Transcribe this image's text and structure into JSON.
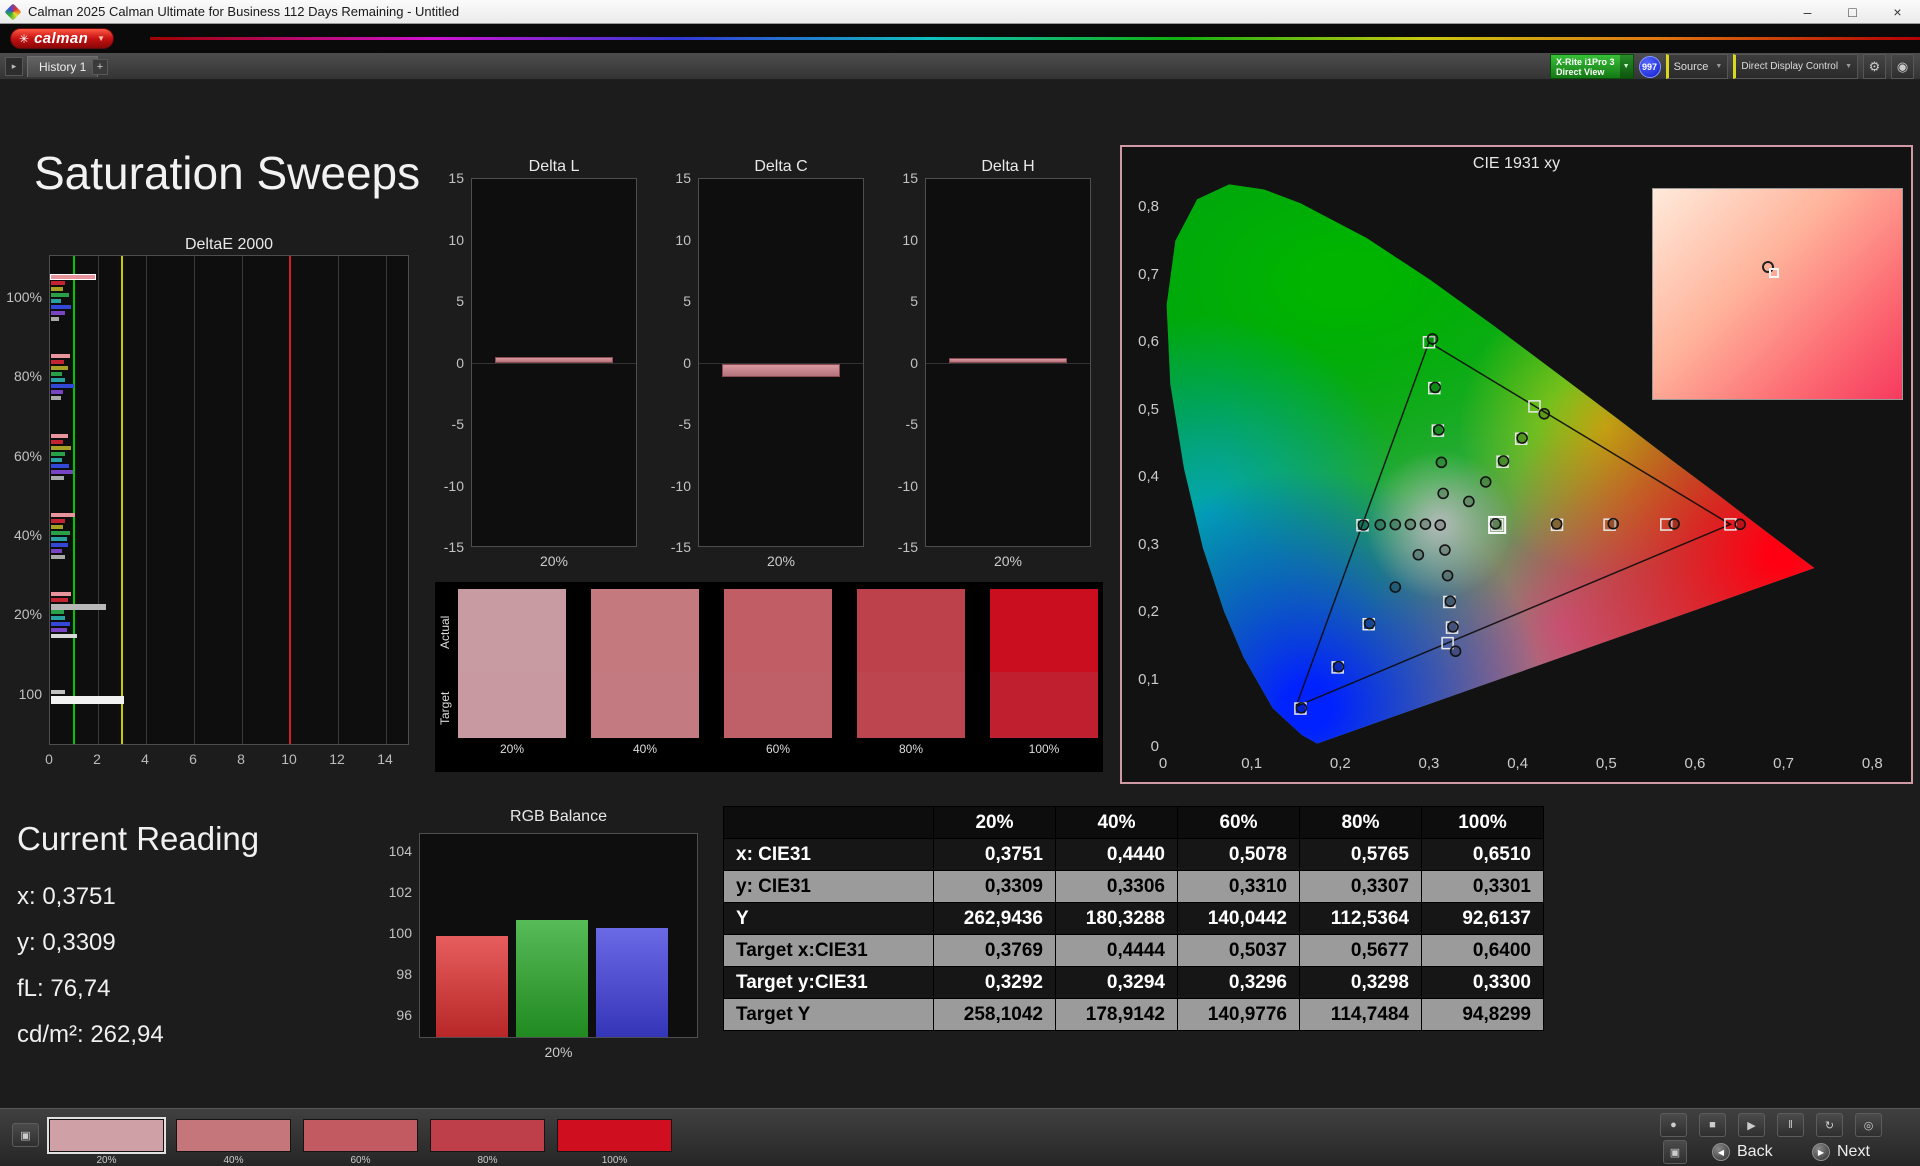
{
  "window": {
    "title": "Calman 2025 Calman Ultimate for Business 112 Days Remaining  - Untitled",
    "minimize": "–",
    "maximize": "□",
    "close": "×"
  },
  "brand": {
    "name": "calman",
    "star": "✳",
    "caret": "▼"
  },
  "toolbar": {
    "history_arrow": "▸",
    "history_tab": "History 1",
    "add_tab": "+",
    "meter_line1": "X-Rite i1Pro 3",
    "meter_line2": "Direct View",
    "meter_count": "997",
    "source_label": "Source",
    "display_control_label": "Direct Display Control",
    "caret": "▼",
    "gear": "⚙",
    "scope": "◉"
  },
  "page_title": "Saturation Sweeps",
  "deltae": {
    "title": "DeltaE 2000",
    "x_ticks": [
      0,
      2,
      4,
      6,
      8,
      10,
      12,
      14
    ],
    "x_max": 15,
    "ref_lines": [
      {
        "value": 1,
        "color": "#00c800"
      },
      {
        "value": 3,
        "color": "#c8c800"
      },
      {
        "value": 10,
        "color": "#d02020"
      }
    ],
    "groups": [
      {
        "label": "100%",
        "bars": [
          {
            "c": "#e8949c",
            "v": 1.85,
            "hl": true
          },
          {
            "c": "#c42432",
            "v": 0.6
          },
          {
            "c": "#a8a022",
            "v": 0.5
          },
          {
            "c": "#28a048",
            "v": 0.75
          },
          {
            "c": "#28a0a0",
            "v": 0.4
          },
          {
            "c": "#3448d8",
            "v": 0.85
          },
          {
            "c": "#7844c4",
            "v": 0.6
          },
          {
            "c": "#a8a8a8",
            "v": 0.35
          }
        ]
      },
      {
        "label": "80%",
        "bars": [
          {
            "c": "#e8949c",
            "v": 0.8
          },
          {
            "c": "#c42432",
            "v": 0.55
          },
          {
            "c": "#a8a022",
            "v": 0.7
          },
          {
            "c": "#28a048",
            "v": 0.45
          },
          {
            "c": "#28a0a0",
            "v": 0.6
          },
          {
            "c": "#3448d8",
            "v": 0.95
          },
          {
            "c": "#7844c4",
            "v": 0.5
          },
          {
            "c": "#a8a8a8",
            "v": 0.4
          }
        ]
      },
      {
        "label": "60%",
        "bars": [
          {
            "c": "#e8949c",
            "v": 0.7
          },
          {
            "c": "#c42432",
            "v": 0.5
          },
          {
            "c": "#a8a022",
            "v": 0.85
          },
          {
            "c": "#28a048",
            "v": 0.6
          },
          {
            "c": "#28a0a0",
            "v": 0.45
          },
          {
            "c": "#3448d8",
            "v": 0.75
          },
          {
            "c": "#7844c4",
            "v": 0.9
          },
          {
            "c": "#a8a8a8",
            "v": 0.55
          }
        ]
      },
      {
        "label": "40%",
        "bars": [
          {
            "c": "#e8949c",
            "v": 1.0
          },
          {
            "c": "#c42432",
            "v": 0.6
          },
          {
            "c": "#a8a022",
            "v": 0.5
          },
          {
            "c": "#28a048",
            "v": 0.8
          },
          {
            "c": "#28a0a0",
            "v": 0.65
          },
          {
            "c": "#3448d8",
            "v": 0.7
          },
          {
            "c": "#7844c4",
            "v": 0.45
          },
          {
            "c": "#a8a8a8",
            "v": 0.6
          }
        ]
      },
      {
        "label": "20%",
        "bars": [
          {
            "c": "#e8949c",
            "v": 0.85
          },
          {
            "c": "#c42432",
            "v": 0.7
          },
          {
            "c": "#b8b8b8",
            "v": 2.3,
            "h": 6
          },
          {
            "c": "#28a048",
            "v": 0.55
          },
          {
            "c": "#28a0a0",
            "v": 0.6
          },
          {
            "c": "#3448d8",
            "v": 0.8
          },
          {
            "c": "#7844c4",
            "v": 0.65
          },
          {
            "c": "#d8d8d8",
            "v": 1.1
          }
        ]
      },
      {
        "label": "100",
        "bars": [
          {
            "c": "#c0c0c0",
            "v": 0.6
          },
          {
            "c": "#f2f2f2",
            "v": 3.05,
            "h": 8
          }
        ]
      }
    ]
  },
  "delta_charts": [
    {
      "title": "Delta L",
      "value": 0.5,
      "x_label": "20%",
      "y_ticks": [
        15,
        10,
        5,
        0,
        -5,
        -10,
        -15
      ],
      "y_max": 15
    },
    {
      "title": "Delta C",
      "value": -1.1,
      "x_label": "20%",
      "y_ticks": [
        15,
        10,
        5,
        0,
        -5,
        -10,
        -15
      ],
      "y_max": 15
    },
    {
      "title": "Delta H",
      "value": 0.45,
      "x_label": "20%",
      "y_ticks": [
        15,
        10,
        5,
        0,
        -5,
        -10,
        -15
      ],
      "y_max": 15
    }
  ],
  "swatch_panel": {
    "row_labels": [
      "Actual",
      "Target"
    ],
    "swatches": [
      {
        "label": "20%",
        "actual": "#c79ba1",
        "target": "#c899a0"
      },
      {
        "label": "40%",
        "actual": "#c4797f",
        "target": "#c37a81"
      },
      {
        "label": "60%",
        "actual": "#c05d65",
        "target": "#bf5f68"
      },
      {
        "label": "80%",
        "actual": "#bd414b",
        "target": "#bc454f"
      },
      {
        "label": "100%",
        "actual": "#cb0e1f",
        "target": "#bf1f2e"
      }
    ]
  },
  "cie": {
    "title": "CIE 1931 xy",
    "x_ticks": [
      "0",
      "0,1",
      "0,2",
      "0,3",
      "0,4",
      "0,5",
      "0,6",
      "0,7",
      "0,8"
    ],
    "y_ticks": [
      "0",
      "0,1",
      "0,2",
      "0,3",
      "0,4",
      "0,5",
      "0,6",
      "0,7",
      "0,8"
    ],
    "x_range": [
      0,
      0.82
    ],
    "y_range": [
      0,
      0.845
    ],
    "triangle": [
      [
        0.64,
        0.33
      ],
      [
        0.3,
        0.6
      ],
      [
        0.15,
        0.06
      ]
    ],
    "measured": [
      [
        0.3751,
        0.3309
      ],
      [
        0.444,
        0.3306
      ],
      [
        0.5078,
        0.331
      ],
      [
        0.5765,
        0.3307
      ],
      [
        0.651,
        0.3301
      ],
      [
        0.296,
        0.3303
      ],
      [
        0.279,
        0.33
      ],
      [
        0.262,
        0.3297
      ],
      [
        0.245,
        0.3294
      ],
      [
        0.226,
        0.3291
      ],
      [
        0.316,
        0.376
      ],
      [
        0.314,
        0.422
      ],
      [
        0.311,
        0.47
      ],
      [
        0.307,
        0.533
      ],
      [
        0.304,
        0.605
      ],
      [
        0.345,
        0.364
      ],
      [
        0.364,
        0.393
      ],
      [
        0.384,
        0.424
      ],
      [
        0.405,
        0.458
      ],
      [
        0.43,
        0.494
      ],
      [
        0.318,
        0.292
      ],
      [
        0.321,
        0.254
      ],
      [
        0.324,
        0.216
      ],
      [
        0.327,
        0.178
      ],
      [
        0.33,
        0.142
      ],
      [
        0.288,
        0.285
      ],
      [
        0.262,
        0.237
      ],
      [
        0.233,
        0.183
      ],
      [
        0.198,
        0.119
      ],
      [
        0.156,
        0.058
      ],
      [
        0.3127,
        0.329
      ]
    ],
    "targets": [
      [
        0.3769,
        0.3292
      ],
      [
        0.4444,
        0.3294
      ],
      [
        0.5037,
        0.3296
      ],
      [
        0.5677,
        0.3298
      ],
      [
        0.64,
        0.33
      ],
      [
        0.225,
        0.3287
      ],
      [
        0.31,
        0.469
      ],
      [
        0.306,
        0.532
      ],
      [
        0.3,
        0.6
      ],
      [
        0.383,
        0.423
      ],
      [
        0.404,
        0.457
      ],
      [
        0.419,
        0.505
      ],
      [
        0.323,
        0.215
      ],
      [
        0.326,
        0.177
      ],
      [
        0.321,
        0.154
      ],
      [
        0.232,
        0.182
      ],
      [
        0.197,
        0.118
      ],
      [
        0.155,
        0.057
      ]
    ],
    "selected_target": [
      0.3769,
      0.3292
    ],
    "inset_marker": [
      0.46,
      0.37
    ]
  },
  "current_reading": {
    "title": "Current Reading",
    "lines": [
      "x: 0,3751",
      "y: 0,3309",
      "fL: 76,74",
      "cd/m²: 262,94"
    ]
  },
  "rgb_balance": {
    "title": "RGB Balance",
    "y_ticks": [
      104,
      102,
      100,
      98,
      96
    ],
    "bars": [
      {
        "name": "red",
        "v": 99.9,
        "c": "#e03030"
      },
      {
        "name": "green",
        "v": 100.7,
        "c": "#28a828"
      },
      {
        "name": "blue",
        "v": 100.3,
        "c": "#4040e0"
      }
    ],
    "x_label": "20%"
  },
  "table": {
    "col_headers": [
      "20%",
      "40%",
      "60%",
      "80%",
      "100%"
    ],
    "rows": [
      {
        "label": "x: CIE31",
        "values": [
          "0,3751",
          "0,4440",
          "0,5078",
          "0,5765",
          "0,6510"
        ]
      },
      {
        "label": "y: CIE31",
        "values": [
          "0,3309",
          "0,3306",
          "0,3310",
          "0,3307",
          "0,3301"
        ]
      },
      {
        "label": "Y",
        "values": [
          "262,9436",
          "180,3288",
          "140,0442",
          "112,5364",
          "92,6137"
        ]
      },
      {
        "label": "Target x:CIE31",
        "values": [
          "0,3769",
          "0,4444",
          "0,5037",
          "0,5677",
          "0,6400"
        ]
      },
      {
        "label": "Target y:CIE31",
        "values": [
          "0,3292",
          "0,3294",
          "0,3296",
          "0,3298",
          "0,3300"
        ]
      },
      {
        "label": "Target Y",
        "values": [
          "258,1042",
          "178,9142",
          "140,9776",
          "114,7484",
          "94,8299"
        ]
      }
    ]
  },
  "bottom_bar": {
    "meter_icon": "▣",
    "swatches": [
      {
        "label": "20%",
        "color": "#cfa0a6",
        "selected": true
      },
      {
        "label": "40%",
        "color": "#c5767b",
        "selected": false
      },
      {
        "label": "60%",
        "color": "#c25a61",
        "selected": false
      },
      {
        "label": "80%",
        "color": "#be3f49",
        "selected": false
      },
      {
        "label": "100%",
        "color": "#cf0f1f",
        "selected": false
      }
    ],
    "icons": [
      {
        "name": "record-icon",
        "glyph": "●"
      },
      {
        "name": "stop-icon",
        "glyph": "■"
      },
      {
        "name": "play-icon",
        "glyph": "▶"
      },
      {
        "name": "pause-icon",
        "glyph": "‖"
      },
      {
        "name": "continuous-read-icon",
        "glyph": "↻"
      },
      {
        "name": "target-icon",
        "glyph": "◎"
      }
    ],
    "layout_button": "▣",
    "back_label": "Back",
    "next_label": "Next",
    "back_glyph": "◀",
    "next_glyph": "▶"
  }
}
